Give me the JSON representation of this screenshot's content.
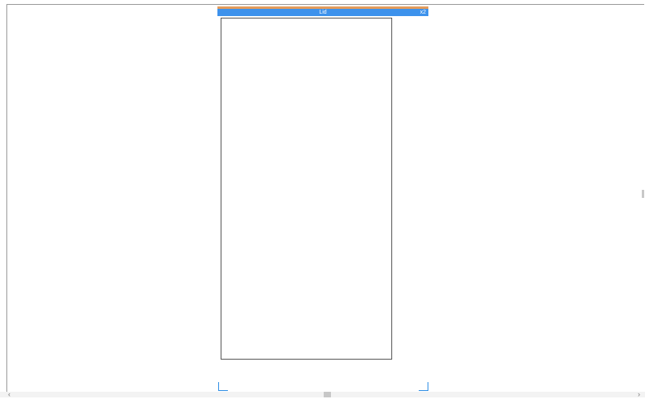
{
  "page_header": {
    "title": "Lid",
    "count": "x2"
  },
  "scrollbar": {
    "left_arrow": "‹",
    "right_arrow": "›"
  },
  "colors": {
    "header_blue": "#3d92ec",
    "header_accent": "#e39b5b",
    "corner_marker": "#2f8fe5"
  }
}
